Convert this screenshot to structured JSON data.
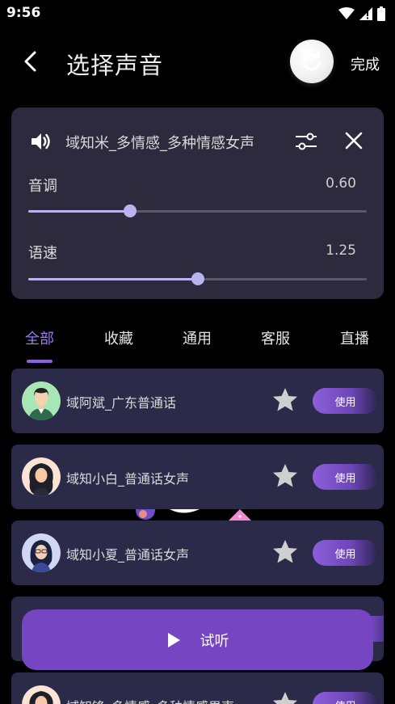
{
  "status_bar": {
    "time": "9:56"
  },
  "header": {
    "title": "选择声音",
    "done_label": "完成"
  },
  "voice_settings": {
    "voice_name": "域知米_多情感_多种情感女声",
    "pitch": {
      "label": "音调",
      "value_text": "0.60",
      "fraction": 0.3
    },
    "speed": {
      "label": "语速",
      "value_text": "1.25",
      "fraction": 0.5
    }
  },
  "tabs": [
    {
      "label": "全部",
      "active": true
    },
    {
      "label": "收藏",
      "active": false
    },
    {
      "label": "通用",
      "active": false
    },
    {
      "label": "客服",
      "active": false
    },
    {
      "label": "直播",
      "active": false
    }
  ],
  "voices": [
    {
      "name": "域阿斌_广东普通话",
      "use_label": "使用",
      "avatar": "male-short-hair-avatar"
    },
    {
      "name": "域知小白_普通话女声",
      "use_label": "使用",
      "avatar": "female-curly-hair-avatar"
    },
    {
      "name": "域知小夏_普通话女声",
      "use_label": "使用",
      "avatar": "female-glasses-avatar"
    },
    {
      "name": "",
      "use_label": "",
      "avatar": ""
    },
    {
      "name": "域知锋_多情感_多种情感男声",
      "use_label": "使用",
      "avatar": "female-curly-hair-avatar"
    }
  ],
  "listen_button": {
    "label": "试听"
  },
  "colors": {
    "accent": "#8b62e6",
    "card": "#2d2a3d",
    "list_item": "#2b2a48",
    "slider": "#b9b4ef",
    "listen_button": "#7545c2"
  }
}
